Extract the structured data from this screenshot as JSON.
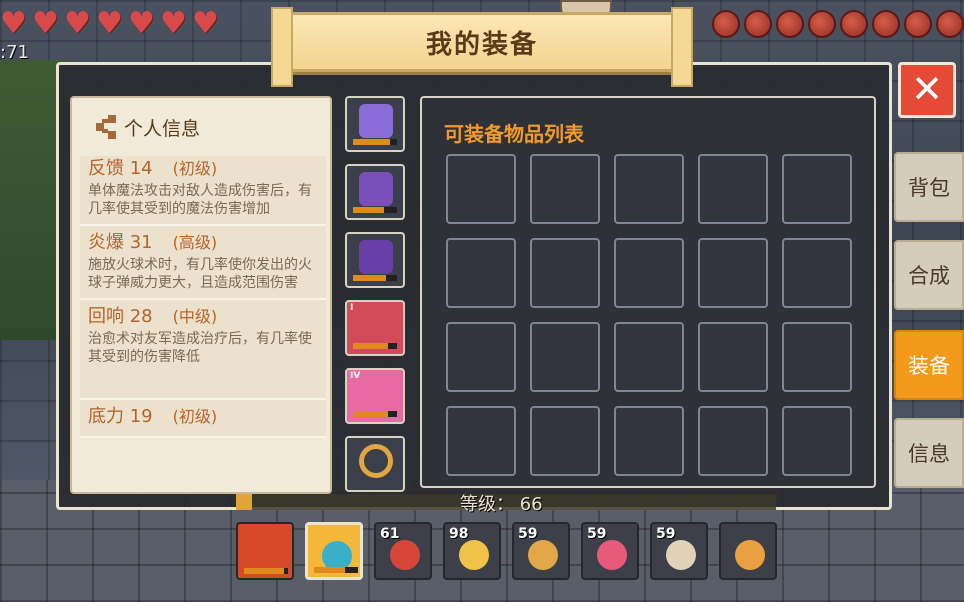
{
  "hud": {
    "hearts_count": 7,
    "stat_text": ":71",
    "hunger_count": 8
  },
  "title": "我的装备",
  "close_icon": "close-icon",
  "info": {
    "title": "个人信息",
    "skills": [
      {
        "name": "反馈 14",
        "level": "(初级)",
        "desc": "单体魔法攻击对敌人造成伤害后，有几率使其受到的魔法伤害增加"
      },
      {
        "name": "炎爆 31",
        "level": "(高级)",
        "desc": "施放火球术时，有几率使你发出的火球子弹威力更大，且造成范围伤害"
      },
      {
        "name": "回响 28",
        "level": "(中级)",
        "desc": "治愈术对友军造成治疗后，有几率使其受到的伤害降低"
      },
      {
        "name": "底力 19",
        "level": "(初级)",
        "desc": ""
      }
    ]
  },
  "equipment": [
    {
      "icon": "crown-icon",
      "color": "#8a6cd6",
      "durability": 0.85,
      "tier": ""
    },
    {
      "icon": "armor-icon",
      "color": "#7a4fb8",
      "durability": 0.7,
      "tier": ""
    },
    {
      "icon": "leggings-icon",
      "color": "#6a3fa8",
      "durability": 0.75,
      "tier": ""
    },
    {
      "icon": "boots-icon",
      "color": "#d34a5a",
      "durability": 0.8,
      "tier": "I"
    },
    {
      "icon": "wings-icon",
      "color": "#e96aa0",
      "durability": 0.8,
      "tier": "IV"
    },
    {
      "icon": "ring-icon",
      "color": "#e0a640",
      "durability": null,
      "tier": ""
    }
  ],
  "list": {
    "title": "可装备物品列表",
    "rows": 4,
    "cols": 5
  },
  "tabs": [
    {
      "label": "背包",
      "active": false
    },
    {
      "label": "合成",
      "active": false
    },
    {
      "label": "装备",
      "active": true
    },
    {
      "label": "信息",
      "active": false
    }
  ],
  "level": {
    "text": "等级： 66",
    "progress": 0.03
  },
  "hotbar": [
    {
      "icon": "crossbow-icon",
      "count": "",
      "color": "#d64a2a",
      "durability": 0.9,
      "selected": false
    },
    {
      "icon": "staff-icon",
      "count": "",
      "color": "#3ab0c8",
      "durability": 0.7,
      "selected": true
    },
    {
      "icon": "meat-icon",
      "count": "61",
      "color": "#d8463a",
      "durability": null,
      "selected": false
    },
    {
      "icon": "flower-cookie-icon",
      "count": "98",
      "color": "#f0c24a",
      "durability": null,
      "selected": false
    },
    {
      "icon": "pie-icon",
      "count": "59",
      "color": "#e2a748",
      "durability": null,
      "selected": false
    },
    {
      "icon": "cocktail-icon",
      "count": "59",
      "color": "#e85a7a",
      "durability": null,
      "selected": false
    },
    {
      "icon": "soup-bowl-icon",
      "count": "59",
      "color": "#e0d2b8",
      "durability": null,
      "selected": false
    },
    {
      "icon": "jug-icon",
      "count": "",
      "color": "#e8a040",
      "durability": null,
      "selected": false
    }
  ]
}
